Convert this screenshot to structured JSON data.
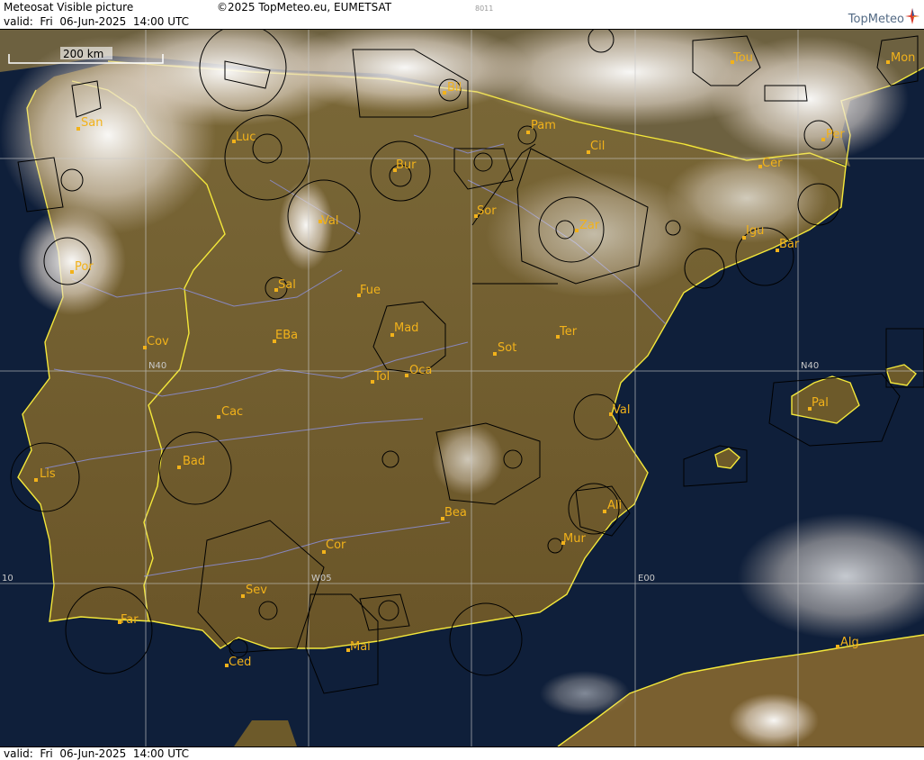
{
  "header": {
    "title": "Meteosat Visible picture",
    "copyright": "©2025 TopMeteo.eu, EUMETSAT",
    "code": "8011",
    "valid": "valid:  Fri  06-Jun-2025  14:00 UTC",
    "logo": "TopMeteo"
  },
  "footer": {
    "valid": "valid:  Fri  06-Jun-2025  14:00 UTC"
  },
  "map": {
    "scale_label": "200 km",
    "grid_labels": [
      "N40",
      "N40",
      "W05",
      "E00",
      "10"
    ],
    "cities": [
      {
        "name": "San"
      },
      {
        "name": "Luc"
      },
      {
        "name": "Bil"
      },
      {
        "name": "Tou"
      },
      {
        "name": "Mon"
      },
      {
        "name": "Pam"
      },
      {
        "name": "Cil"
      },
      {
        "name": "Per"
      },
      {
        "name": "Bur"
      },
      {
        "name": "Cer"
      },
      {
        "name": "Val"
      },
      {
        "name": "Sor"
      },
      {
        "name": "Zar"
      },
      {
        "name": "Igu"
      },
      {
        "name": "Bar"
      },
      {
        "name": "Por"
      },
      {
        "name": "Sal"
      },
      {
        "name": "Fue"
      },
      {
        "name": "Mad"
      },
      {
        "name": "Cov"
      },
      {
        "name": "EBa"
      },
      {
        "name": "Ter"
      },
      {
        "name": "Sot"
      },
      {
        "name": "Tol"
      },
      {
        "name": "Oca"
      },
      {
        "name": "Pal"
      },
      {
        "name": "Cac"
      },
      {
        "name": "Val"
      },
      {
        "name": "Bad"
      },
      {
        "name": "Lis"
      },
      {
        "name": "Ali"
      },
      {
        "name": "Bea"
      },
      {
        "name": "Cor"
      },
      {
        "name": "Mur"
      },
      {
        "name": "Sev"
      },
      {
        "name": "Far"
      },
      {
        "name": "Mal"
      },
      {
        "name": "Alg"
      },
      {
        "name": "Ced"
      }
    ],
    "colors": {
      "sea": "#0f1f3a",
      "land": "#6b5a30",
      "coast": "#f4e83a",
      "city": "#f2b21a",
      "river": "#8c8fd8"
    }
  }
}
